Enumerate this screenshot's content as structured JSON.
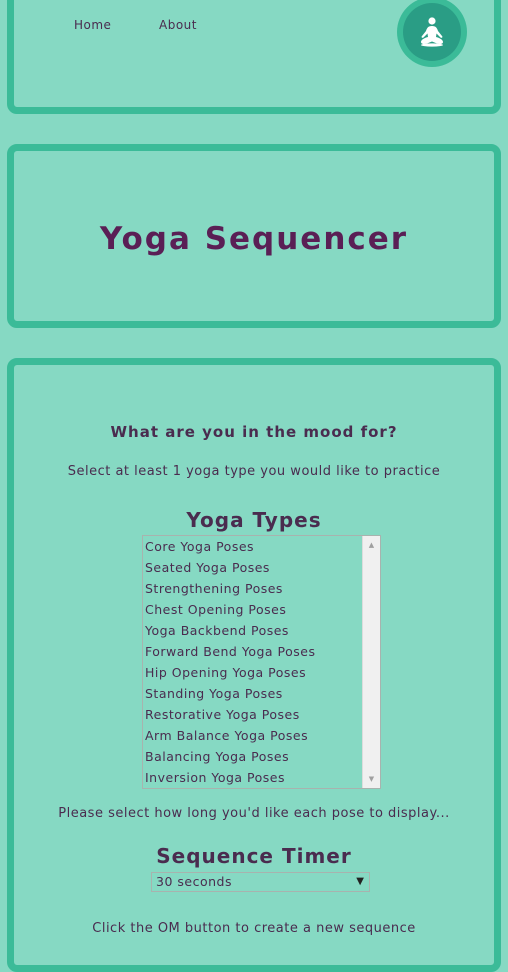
{
  "nav": {
    "home": "Home",
    "about": "About",
    "logo_icon": "meditation-pose-icon"
  },
  "header": {
    "title": "Yoga Sequencer"
  },
  "main": {
    "mood_heading": "What are you in the mood for?",
    "select_instructions": "Select at least 1 yoga type you would like to practice",
    "types_heading": "Yoga Types",
    "yoga_types": [
      "Core Yoga Poses",
      "Seated Yoga Poses",
      "Strengthening Poses",
      "Chest Opening Poses",
      "Yoga Backbend Poses",
      "Forward Bend Yoga Poses",
      "Hip Opening Yoga Poses",
      "Standing Yoga Poses",
      "Restorative Yoga Poses",
      "Arm Balance Yoga Poses",
      "Balancing Yoga Poses",
      "Inversion Yoga Poses"
    ],
    "duration_instructions": "Please select how long you'd like each pose to display...",
    "timer_heading": "Sequence Timer",
    "timer_value": "30 seconds",
    "om_instructions": "Click the OM button to create a new sequence"
  },
  "colors": {
    "background": "#86d9c3",
    "border": "#3bbb98",
    "title": "#5a1f55",
    "text": "#4a2c4f"
  }
}
